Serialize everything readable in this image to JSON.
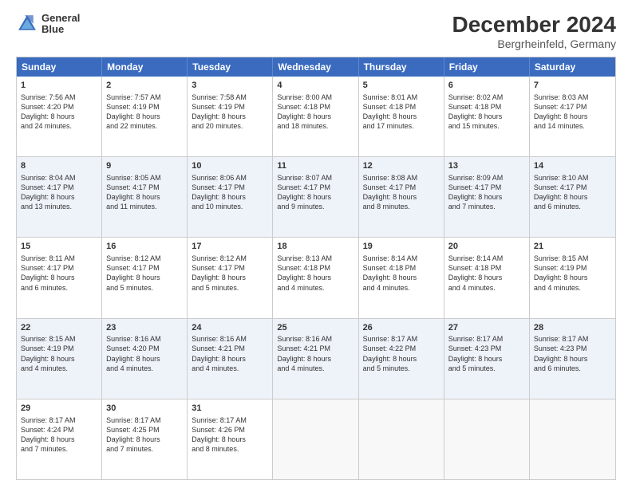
{
  "header": {
    "logo_line1": "General",
    "logo_line2": "Blue",
    "title": "December 2024",
    "subtitle": "Bergrheinfeld, Germany"
  },
  "calendar": {
    "weekdays": [
      "Sunday",
      "Monday",
      "Tuesday",
      "Wednesday",
      "Thursday",
      "Friday",
      "Saturday"
    ],
    "rows": [
      [
        {
          "day": "1",
          "lines": [
            "Sunrise: 7:56 AM",
            "Sunset: 4:20 PM",
            "Daylight: 8 hours",
            "and 24 minutes."
          ]
        },
        {
          "day": "2",
          "lines": [
            "Sunrise: 7:57 AM",
            "Sunset: 4:19 PM",
            "Daylight: 8 hours",
            "and 22 minutes."
          ]
        },
        {
          "day": "3",
          "lines": [
            "Sunrise: 7:58 AM",
            "Sunset: 4:19 PM",
            "Daylight: 8 hours",
            "and 20 minutes."
          ]
        },
        {
          "day": "4",
          "lines": [
            "Sunrise: 8:00 AM",
            "Sunset: 4:18 PM",
            "Daylight: 8 hours",
            "and 18 minutes."
          ]
        },
        {
          "day": "5",
          "lines": [
            "Sunrise: 8:01 AM",
            "Sunset: 4:18 PM",
            "Daylight: 8 hours",
            "and 17 minutes."
          ]
        },
        {
          "day": "6",
          "lines": [
            "Sunrise: 8:02 AM",
            "Sunset: 4:18 PM",
            "Daylight: 8 hours",
            "and 15 minutes."
          ]
        },
        {
          "day": "7",
          "lines": [
            "Sunrise: 8:03 AM",
            "Sunset: 4:17 PM",
            "Daylight: 8 hours",
            "and 14 minutes."
          ]
        }
      ],
      [
        {
          "day": "8",
          "lines": [
            "Sunrise: 8:04 AM",
            "Sunset: 4:17 PM",
            "Daylight: 8 hours",
            "and 13 minutes."
          ]
        },
        {
          "day": "9",
          "lines": [
            "Sunrise: 8:05 AM",
            "Sunset: 4:17 PM",
            "Daylight: 8 hours",
            "and 11 minutes."
          ]
        },
        {
          "day": "10",
          "lines": [
            "Sunrise: 8:06 AM",
            "Sunset: 4:17 PM",
            "Daylight: 8 hours",
            "and 10 minutes."
          ]
        },
        {
          "day": "11",
          "lines": [
            "Sunrise: 8:07 AM",
            "Sunset: 4:17 PM",
            "Daylight: 8 hours",
            "and 9 minutes."
          ]
        },
        {
          "day": "12",
          "lines": [
            "Sunrise: 8:08 AM",
            "Sunset: 4:17 PM",
            "Daylight: 8 hours",
            "and 8 minutes."
          ]
        },
        {
          "day": "13",
          "lines": [
            "Sunrise: 8:09 AM",
            "Sunset: 4:17 PM",
            "Daylight: 8 hours",
            "and 7 minutes."
          ]
        },
        {
          "day": "14",
          "lines": [
            "Sunrise: 8:10 AM",
            "Sunset: 4:17 PM",
            "Daylight: 8 hours",
            "and 6 minutes."
          ]
        }
      ],
      [
        {
          "day": "15",
          "lines": [
            "Sunrise: 8:11 AM",
            "Sunset: 4:17 PM",
            "Daylight: 8 hours",
            "and 6 minutes."
          ]
        },
        {
          "day": "16",
          "lines": [
            "Sunrise: 8:12 AM",
            "Sunset: 4:17 PM",
            "Daylight: 8 hours",
            "and 5 minutes."
          ]
        },
        {
          "day": "17",
          "lines": [
            "Sunrise: 8:12 AM",
            "Sunset: 4:17 PM",
            "Daylight: 8 hours",
            "and 5 minutes."
          ]
        },
        {
          "day": "18",
          "lines": [
            "Sunrise: 8:13 AM",
            "Sunset: 4:18 PM",
            "Daylight: 8 hours",
            "and 4 minutes."
          ]
        },
        {
          "day": "19",
          "lines": [
            "Sunrise: 8:14 AM",
            "Sunset: 4:18 PM",
            "Daylight: 8 hours",
            "and 4 minutes."
          ]
        },
        {
          "day": "20",
          "lines": [
            "Sunrise: 8:14 AM",
            "Sunset: 4:18 PM",
            "Daylight: 8 hours",
            "and 4 minutes."
          ]
        },
        {
          "day": "21",
          "lines": [
            "Sunrise: 8:15 AM",
            "Sunset: 4:19 PM",
            "Daylight: 8 hours",
            "and 4 minutes."
          ]
        }
      ],
      [
        {
          "day": "22",
          "lines": [
            "Sunrise: 8:15 AM",
            "Sunset: 4:19 PM",
            "Daylight: 8 hours",
            "and 4 minutes."
          ]
        },
        {
          "day": "23",
          "lines": [
            "Sunrise: 8:16 AM",
            "Sunset: 4:20 PM",
            "Daylight: 8 hours",
            "and 4 minutes."
          ]
        },
        {
          "day": "24",
          "lines": [
            "Sunrise: 8:16 AM",
            "Sunset: 4:21 PM",
            "Daylight: 8 hours",
            "and 4 minutes."
          ]
        },
        {
          "day": "25",
          "lines": [
            "Sunrise: 8:16 AM",
            "Sunset: 4:21 PM",
            "Daylight: 8 hours",
            "and 4 minutes."
          ]
        },
        {
          "day": "26",
          "lines": [
            "Sunrise: 8:17 AM",
            "Sunset: 4:22 PM",
            "Daylight: 8 hours",
            "and 5 minutes."
          ]
        },
        {
          "day": "27",
          "lines": [
            "Sunrise: 8:17 AM",
            "Sunset: 4:23 PM",
            "Daylight: 8 hours",
            "and 5 minutes."
          ]
        },
        {
          "day": "28",
          "lines": [
            "Sunrise: 8:17 AM",
            "Sunset: 4:23 PM",
            "Daylight: 8 hours",
            "and 6 minutes."
          ]
        }
      ],
      [
        {
          "day": "29",
          "lines": [
            "Sunrise: 8:17 AM",
            "Sunset: 4:24 PM",
            "Daylight: 8 hours",
            "and 7 minutes."
          ]
        },
        {
          "day": "30",
          "lines": [
            "Sunrise: 8:17 AM",
            "Sunset: 4:25 PM",
            "Daylight: 8 hours",
            "and 7 minutes."
          ]
        },
        {
          "day": "31",
          "lines": [
            "Sunrise: 8:17 AM",
            "Sunset: 4:26 PM",
            "Daylight: 8 hours",
            "and 8 minutes."
          ]
        },
        {
          "day": "",
          "lines": []
        },
        {
          "day": "",
          "lines": []
        },
        {
          "day": "",
          "lines": []
        },
        {
          "day": "",
          "lines": []
        }
      ]
    ]
  }
}
